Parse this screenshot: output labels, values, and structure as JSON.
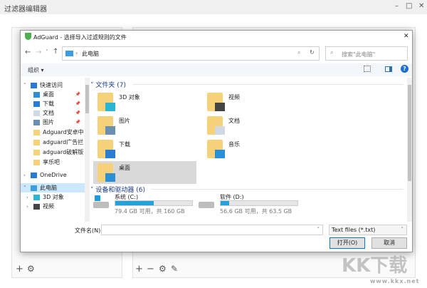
{
  "window": {
    "title": "过滤器编辑器",
    "minimize": "–",
    "maximize": "□",
    "close": "✕"
  },
  "dialog": {
    "title": "AdGuard - 选择导入过滤规则的文件",
    "close": "✕",
    "address": "此电脑",
    "search_placeholder": "搜索\"此电脑\"",
    "organize": "组织 ▾",
    "nav_tree": [
      {
        "label": "快速访问",
        "icon": "star-icon"
      },
      {
        "label": "桌面",
        "icon": "desktop-icon",
        "pinned": true
      },
      {
        "label": "下载",
        "icon": "download-icon",
        "pinned": true
      },
      {
        "label": "文档",
        "icon": "document-icon",
        "pinned": true
      },
      {
        "label": "图片",
        "icon": "picture-icon",
        "pinned": true
      },
      {
        "label": "Adguard安卓中",
        "icon": "folder-icon"
      },
      {
        "label": "adguard广告拦",
        "icon": "folder-icon"
      },
      {
        "label": "adguard破解版",
        "icon": "folder-icon"
      },
      {
        "label": "享乐吧",
        "icon": "folder-icon"
      },
      {
        "label": "OneDrive",
        "icon": "cloud-icon"
      },
      {
        "label": "此电脑",
        "icon": "computer-icon",
        "selected": true
      },
      {
        "label": "3D 对象",
        "icon": "cube-icon"
      },
      {
        "label": "视频",
        "icon": "video-icon"
      }
    ],
    "folders_header": "文件夹 (7)",
    "folders": [
      {
        "label": "3D 对象",
        "icon": "cube-icon"
      },
      {
        "label": "视频",
        "icon": "video-icon"
      },
      {
        "label": "图片",
        "icon": "picture-icon"
      },
      {
        "label": "文档",
        "icon": "document-icon"
      },
      {
        "label": "下载",
        "icon": "download-icon"
      },
      {
        "label": "音乐",
        "icon": "music-icon"
      },
      {
        "label": "桌面",
        "icon": "desktop-icon",
        "selected": true
      }
    ],
    "drives_header": "设备和驱动器 (6)",
    "drives": [
      {
        "label": "系统 (C:)",
        "info": "79.4 GB 可用，共 160 GB",
        "used_percent": 50
      },
      {
        "label": "软件 (D:)",
        "info": "56.6 GB 可用，共 63.5 GB",
        "used_percent": 11
      }
    ],
    "filename_label": "文件名(N):",
    "filename_value": "",
    "filetype": "Text files (*.txt)",
    "open_button": "打开(O)",
    "cancel_button": "取消"
  },
  "watermark": {
    "logo": "KK下载",
    "url": "www.kkx.net"
  }
}
